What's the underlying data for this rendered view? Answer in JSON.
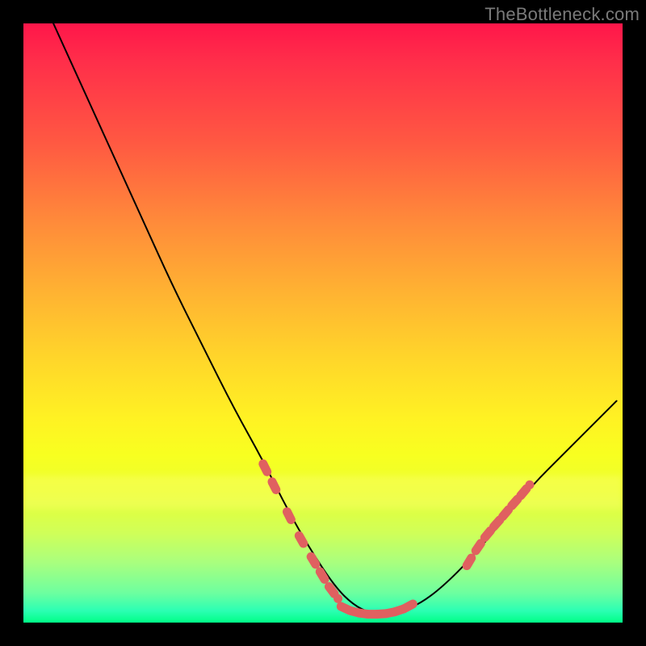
{
  "watermark": "TheBottleneck.com",
  "chart_data": {
    "type": "line",
    "title": "",
    "xlabel": "",
    "ylabel": "",
    "xlim": [
      0,
      100
    ],
    "ylim": [
      0,
      100
    ],
    "grid": false,
    "legend_position": "none",
    "series": [
      {
        "name": "bottleneck-curve",
        "x": [
          5,
          10,
          15,
          20,
          25,
          30,
          35,
          40,
          44,
          48,
          52,
          55,
          58,
          62,
          66,
          70,
          75,
          80,
          85,
          90,
          95,
          99
        ],
        "y": [
          100,
          89,
          78,
          67,
          56,
          46,
          36,
          27,
          19,
          12,
          6,
          3,
          1.5,
          1.5,
          3,
          6,
          11,
          17,
          23,
          28,
          33,
          37
        ]
      },
      {
        "name": "left-dashed-highlight",
        "x": [
          40,
          41.5,
          44,
          46,
          48,
          49.5,
          51,
          52.5
        ],
        "y": [
          26.5,
          23.5,
          18.5,
          14.5,
          11,
          8.5,
          6,
          4
        ],
        "style": "dashed"
      },
      {
        "name": "floor-dashed-highlight",
        "x": [
          53,
          54.5,
          56,
          57.5,
          59,
          60.5,
          62,
          63.5,
          65
        ],
        "y": [
          2.7,
          2.0,
          1.6,
          1.4,
          1.4,
          1.5,
          1.8,
          2.3,
          3.1
        ],
        "style": "dashed"
      },
      {
        "name": "right-dashed-highlight",
        "x": [
          74,
          75.5,
          77,
          78.5,
          80,
          81.5,
          83,
          84.5
        ],
        "y": [
          9.5,
          12,
          14.2,
          16.0,
          17.7,
          19.5,
          21.2,
          23
        ],
        "style": "dashed"
      }
    ],
    "gradient_stops": [
      {
        "pos": 0,
        "color": "#ff164a"
      },
      {
        "pos": 20,
        "color": "#ff5942"
      },
      {
        "pos": 45,
        "color": "#ffb332"
      },
      {
        "pos": 66,
        "color": "#fff223"
      },
      {
        "pos": 85,
        "color": "#d0ff58"
      },
      {
        "pos": 100,
        "color": "#00ff86"
      }
    ]
  }
}
